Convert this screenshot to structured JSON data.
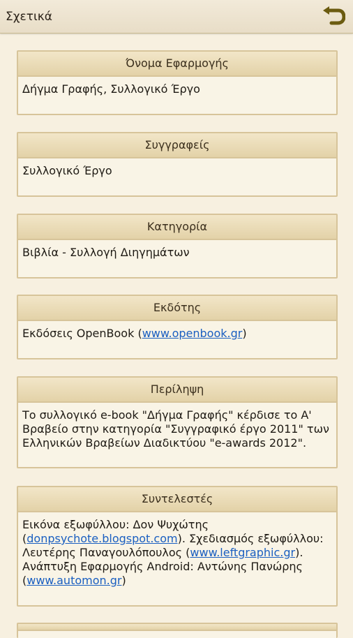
{
  "header": {
    "title": "Σχετικά"
  },
  "cards": [
    {
      "heading": "Όνομα Εφαρμογής",
      "text": "Δήγμα Γραφής, Συλλογικό Έργο"
    },
    {
      "heading": "Συγγραφείς",
      "text": "Συλλογικό Έργο"
    },
    {
      "heading": "Κατηγορία",
      "text": "Βιβλία - Συλλογή Διηγημάτων"
    },
    {
      "heading": "Εκδότης",
      "text_before": "Εκδόσεις OpenBook (",
      "link": "www.openbook.gr",
      "text_after": ")"
    },
    {
      "heading": "Περίληψη",
      "lines": [
        "Το συλλογικό e-book \"Δήγμα Γραφής\" κέρδισε το Α'",
        "Βραβείο  στην κατηγορία \"Συγγραφικό έργο 2011\" των",
        "Ελληνικών Βραβείων Διαδικτύου \"e-awards 2012\"."
      ]
    },
    {
      "heading": "Συντελεστές",
      "l1": "Εικόνα εξωφύλλου: Δον Ψυχώτης",
      "l2_open": "(",
      "link1": "donpsychote.blogspot.com",
      "l2_rest": "). Σχεδιασμός εξωφύλλου:",
      "l3_text": "Λευτέρης Παναγουλόπουλος (",
      "link2": "www.leftgraphic.gr",
      "l3_close": ").",
      "l4": "Ανάπτυξη Εφαρμογής Android: Αντώνης Πανώρης",
      "l5_open": "(",
      "link3": "www.automon.gr",
      "l5_close": ")"
    }
  ],
  "colors": {
    "link": "#1a5fc1",
    "accent": "#6b5b10",
    "card_border": "#d7c49a"
  },
  "icons": {
    "back": "undo-arrow-icon"
  }
}
